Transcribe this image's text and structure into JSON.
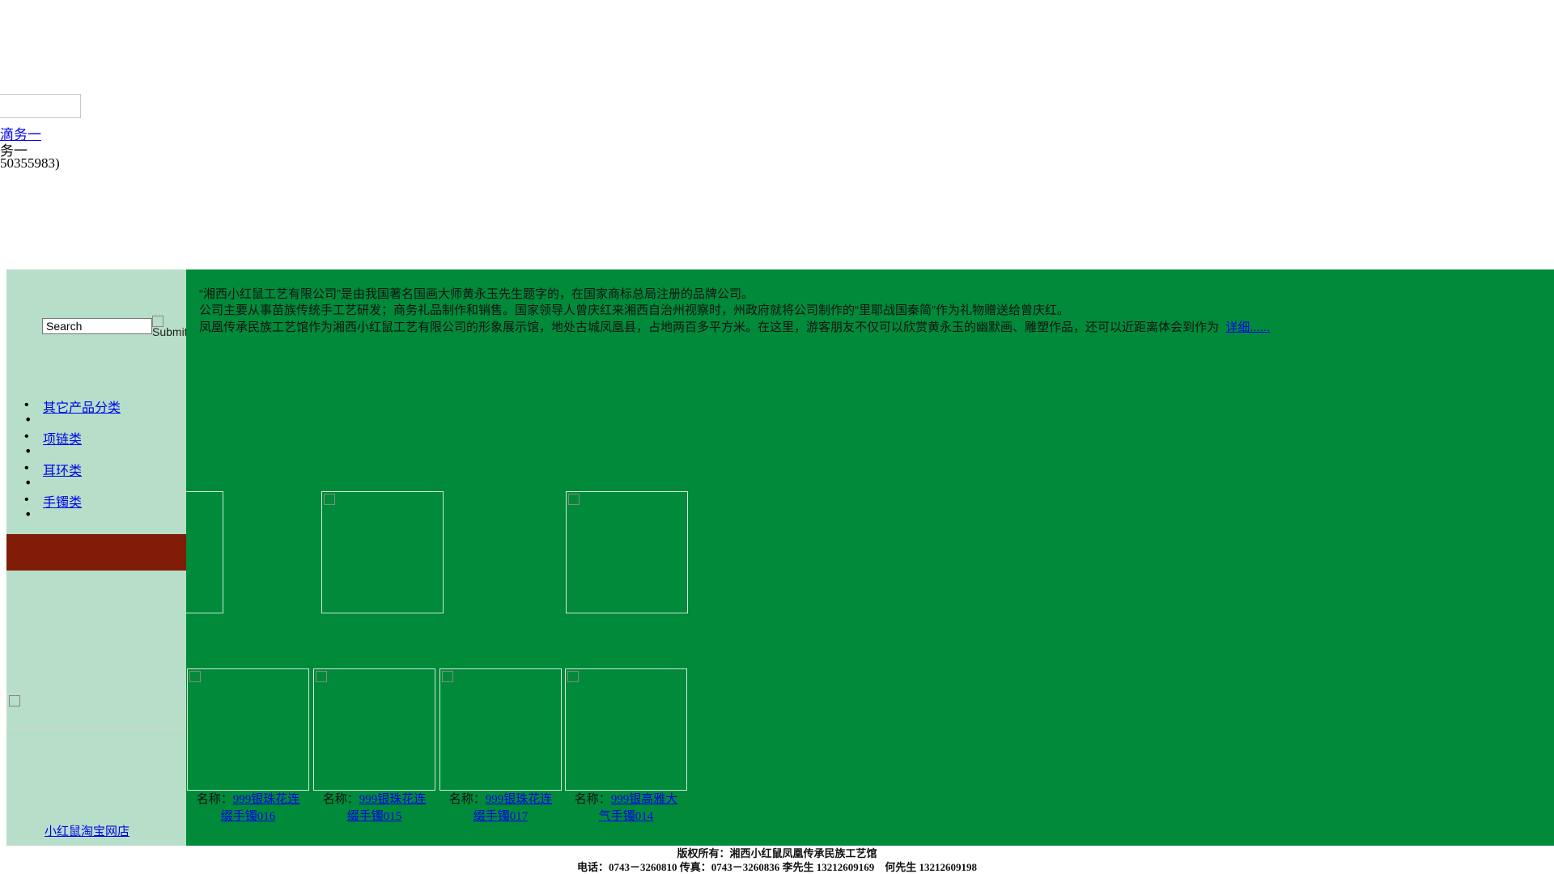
{
  "top": {
    "link_text": "滴务一",
    "text_line1": "务一",
    "text_line2": "50355983)"
  },
  "sidebar": {
    "search_placeholder": "Search",
    "submit_label": "Submit",
    "categories": [
      {
        "label": "其它产品分类"
      },
      {
        "label": "项链类"
      },
      {
        "label": "耳环类"
      },
      {
        "label": "手镯类"
      }
    ],
    "shop_link": "小红鼠淘宝网店"
  },
  "intro": {
    "line1": "“湘西小红鼠工艺有限公司”是由我国著名国画大师黄永玉先生题字的，在国家商标总局注册的品牌公司。",
    "line2": "公司主要从事苗族传统手工艺研发；商务礼品制作和销售。国家领导人曾庆红来湘西自治州视察时，州政府就将公司制作的“里耶战国秦简”作为礼物赠送给曾庆红。",
    "line3": "凤凰传承民族工艺馆作为湘西小红鼠工艺有限公司的形象展示馆，地处古城凤凰县，占地两百多平方米。在这里，游客朋友不仅可以欣赏黄永玉的幽默画、雕塑作品，还可以近距离体会到作为",
    "more_link": "详细......"
  },
  "products_row2": [
    {
      "label": "名称：",
      "name_line1": "999银珠花连",
      "name_line2": "缀手镯016"
    },
    {
      "label": "名称：",
      "name_line1": "999银珠花连",
      "name_line2": "缀手镯015"
    },
    {
      "label": "名称：",
      "name_line1": "999银珠花连",
      "name_line2": "缀手镯017"
    },
    {
      "label": "名称：",
      "name_line1": "999银高雅大",
      "name_line2": "气手镯014"
    }
  ],
  "footer": {
    "line1": "版权所有：湘西小红鼠凤凰传承民族工艺馆",
    "line2": "电话：0743－3260810 传真：0743－3260836 李先生 13212609169　何先生 13212609198"
  },
  "colors": {
    "main_bg": "#008a3a",
    "sidebar_bg": "#b7dec8",
    "red_bar": "#801c08"
  }
}
